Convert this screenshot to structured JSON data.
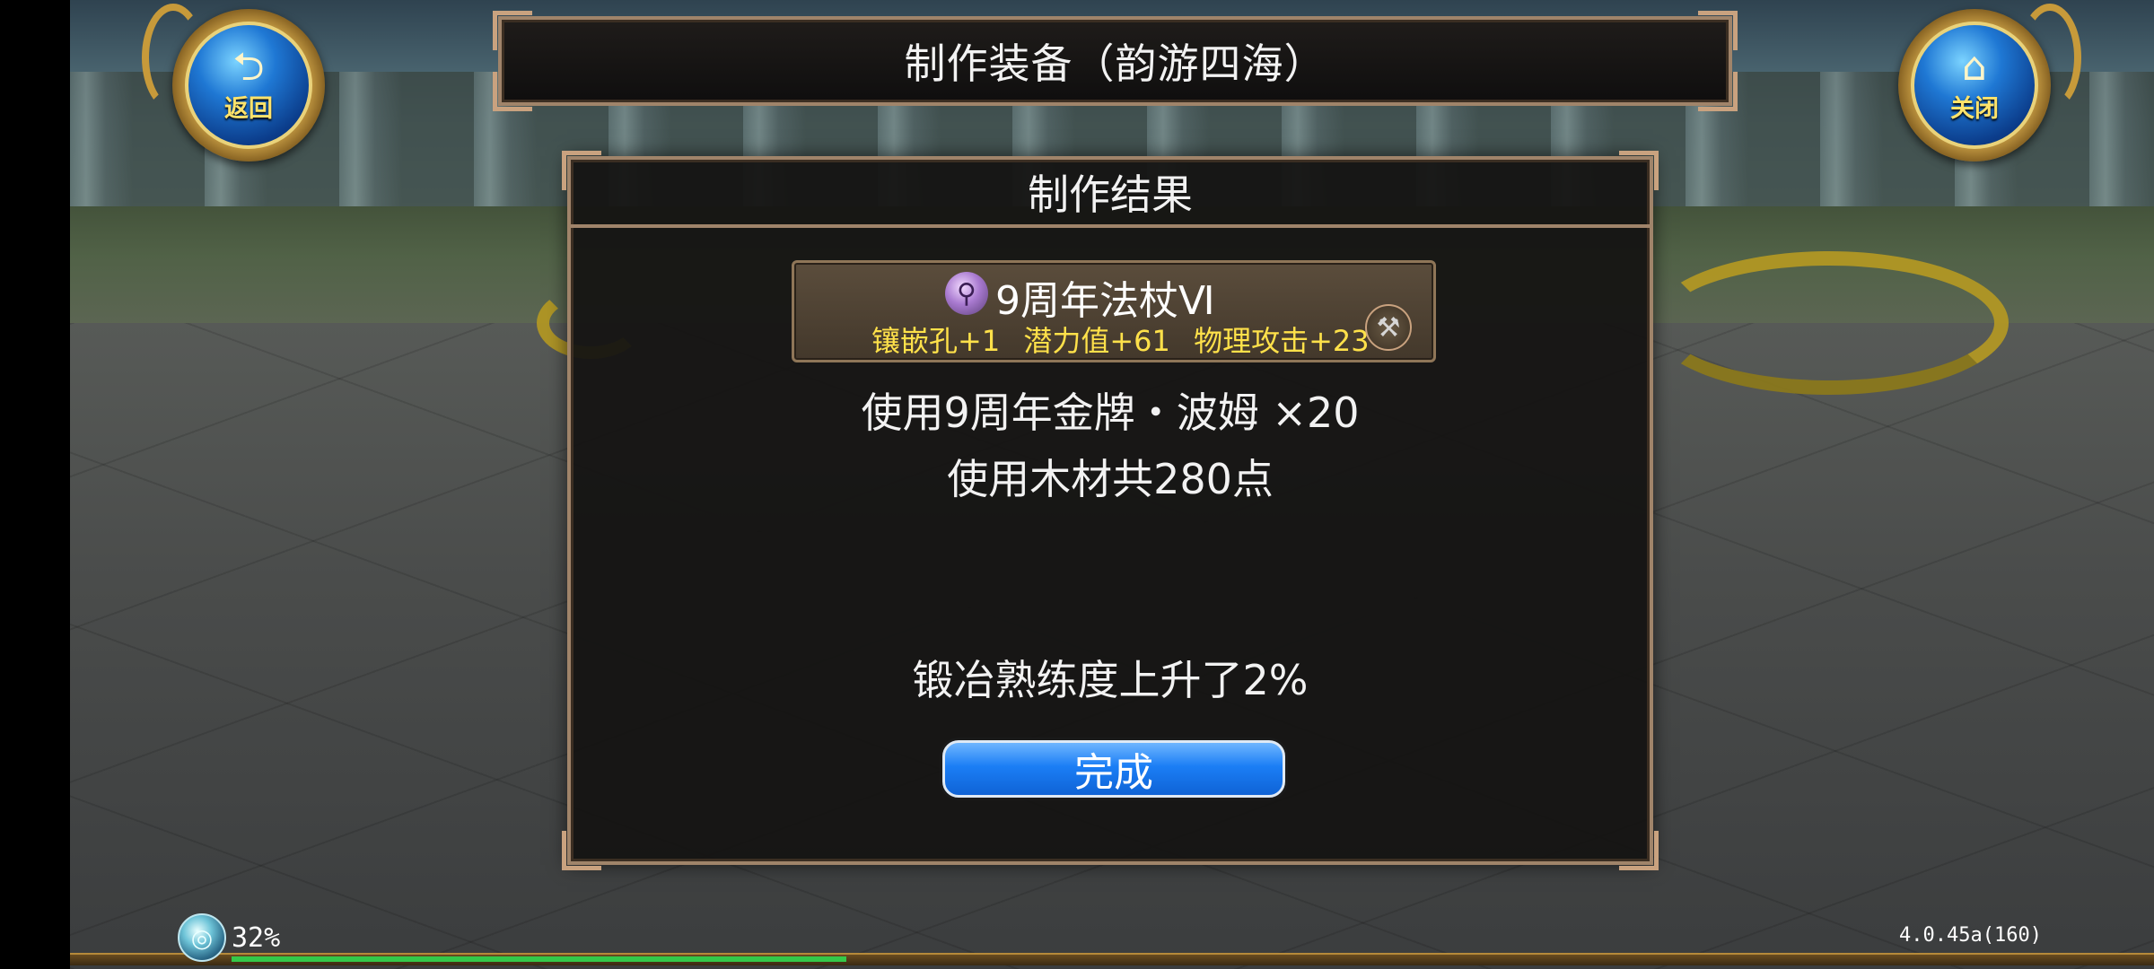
{
  "header": {
    "back_button": {
      "icon": "back-arrow-icon",
      "label": "返回"
    },
    "close_button": {
      "icon": "home-icon",
      "label": "关闭"
    },
    "title": "制作装备（韵游四海）"
  },
  "dialog": {
    "title": "制作结果",
    "item": {
      "icon": "staff-icon",
      "name": "9周年法杖Ⅵ",
      "stats": [
        "镶嵌孔+1",
        "潜力值+61",
        "物理攻击+23"
      ],
      "action_icon": "anvil-icon"
    },
    "material_used": "使用9周年金牌・波姆 ×20",
    "wood_used": "使用木材共280点",
    "skill_message": "锻冶熟练度上升了2%",
    "done_button": "完成"
  },
  "hud": {
    "icon": "orb-icon",
    "exp_percent_text": "32%",
    "exp_fraction": 0.32,
    "version": "4.0.45a(160)"
  },
  "colors": {
    "accent_gold": "#c9a27f",
    "button_blue": "#1b7ef5",
    "stat_yellow": "#ffe14a",
    "exp_green": "#34c94a"
  }
}
